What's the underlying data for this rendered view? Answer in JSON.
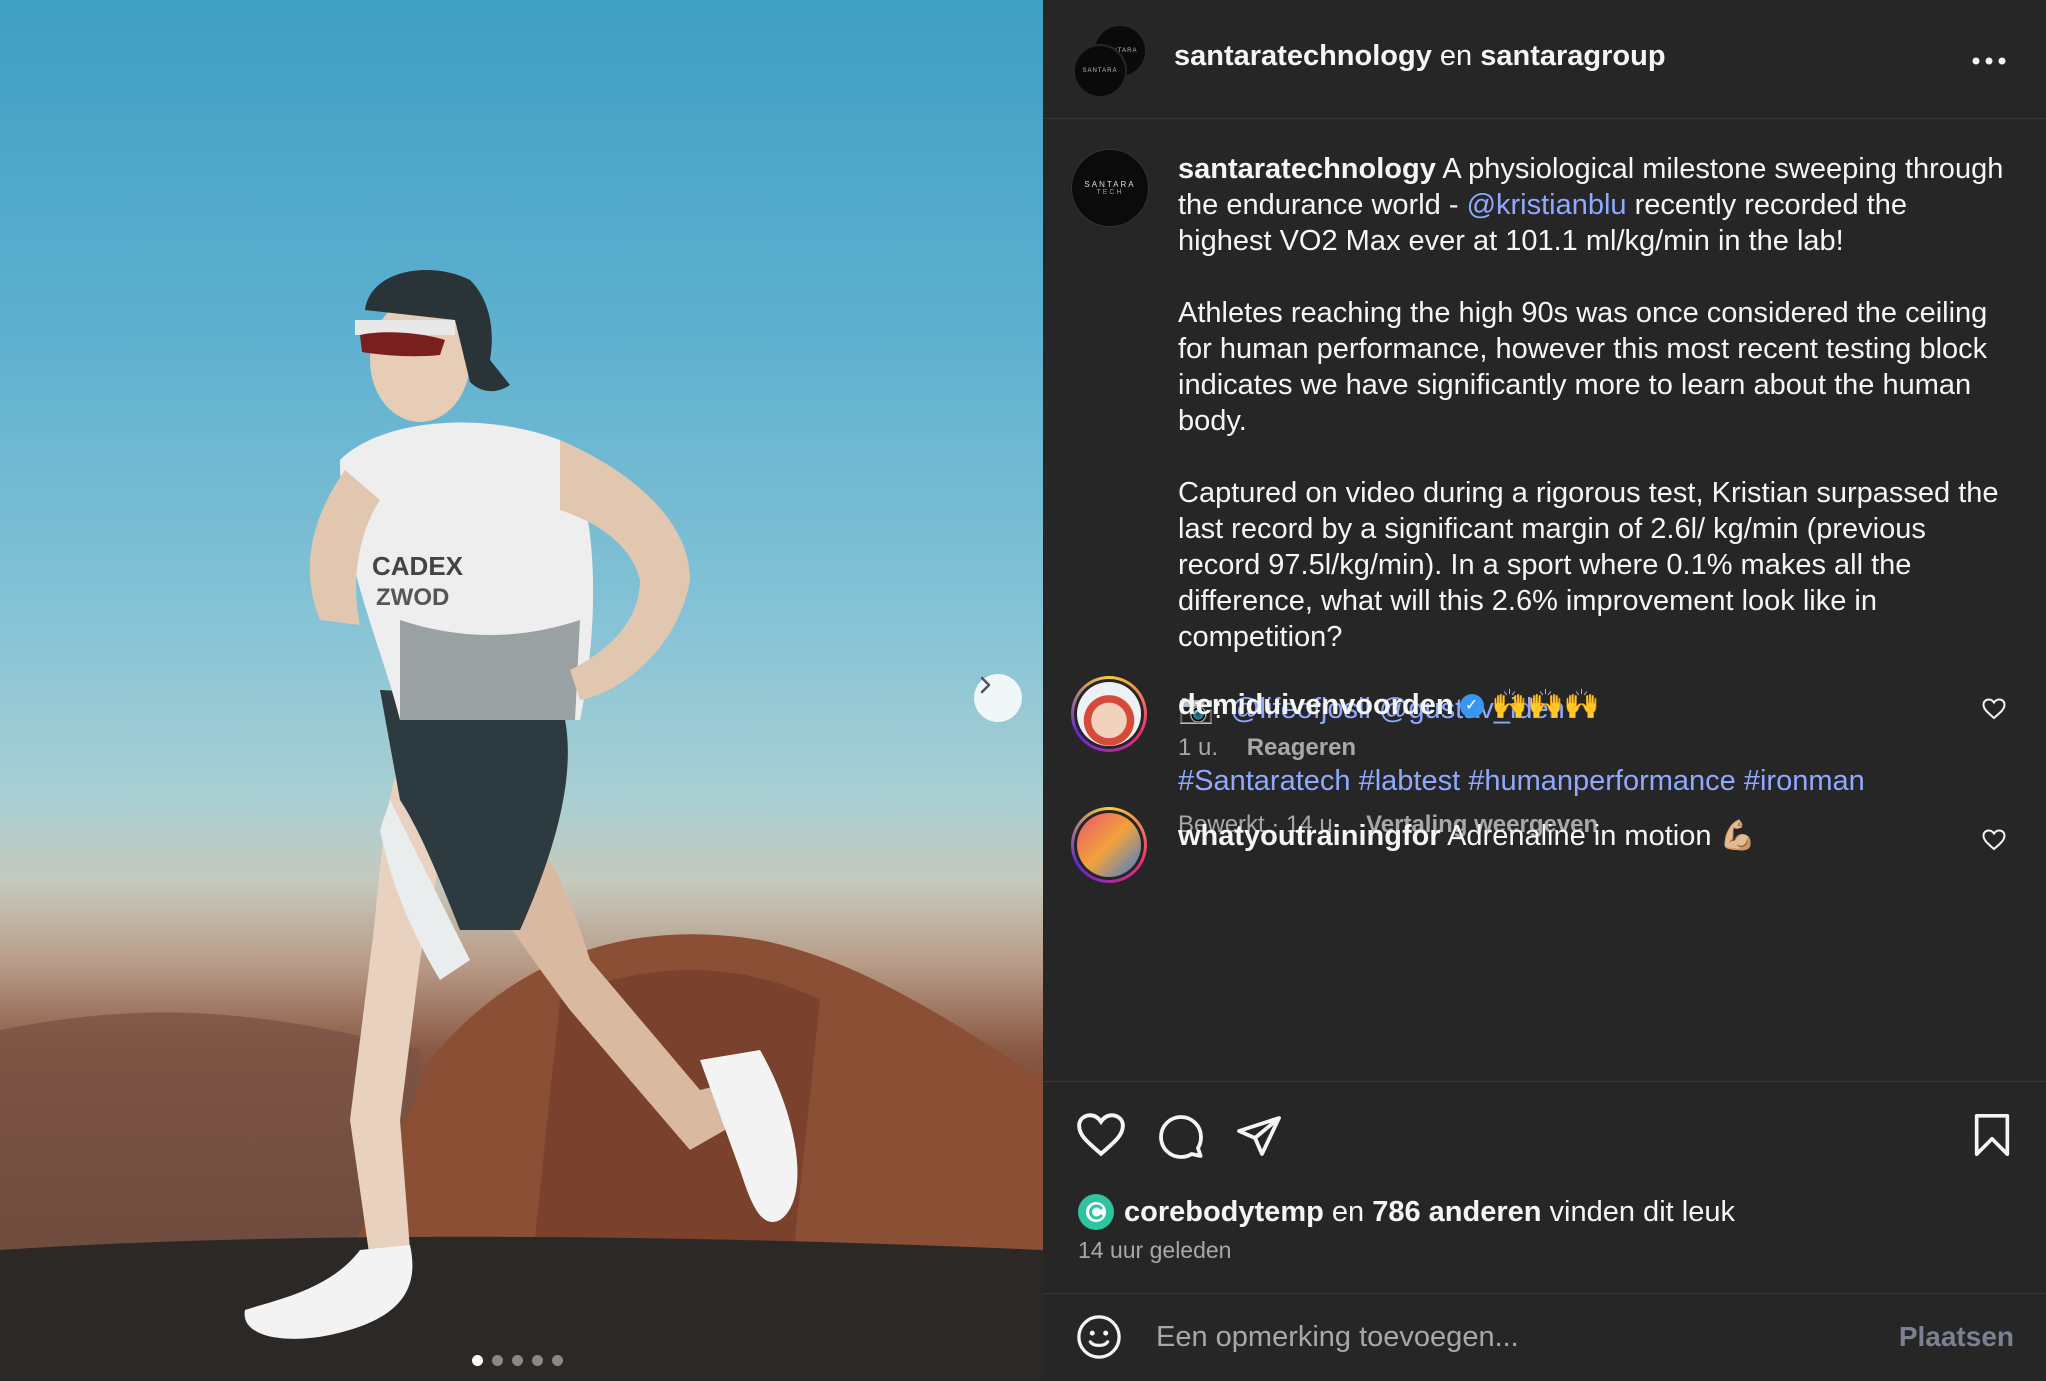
{
  "header": {
    "user1": "santaratechnology",
    "joiner": "en",
    "user2": "santaragroup",
    "avatar_text": "SANTARA"
  },
  "caption": {
    "avatar_line1": "SANTARA",
    "avatar_line2": "TECH",
    "username": "santaratechnology",
    "p1_a": "A physiological milestone sweeping through the endurance world - ",
    "p1_mention": "@kristianblu",
    "p1_b": " recently recorded the highest VO2 Max ever at 101.1 ml/kg/min in the lab!",
    "p2": "Athletes reaching the high 90s was once considered the ceiling for human performance, however this most recent testing block indicates we have significantly more to learn about the human body.",
    "p3": "Captured on video during a rigorous test, Kristian surpassed the last record by a significant margin of 2.6l/ kg/min (previous record 97.5l/kg/min). In a sport where 0.1% makes all the difference, what will this 2.6% improvement look like in competition?",
    "camera": "📷:",
    "credit1": "@lifeofjosii",
    "credit2": "@gustav_iden",
    "hashtags": "#Santaratech #labtest #humanperformance #ironman",
    "edited": "Bewerkt · 14 u.",
    "translate": "Vertaling weergeven"
  },
  "comments": [
    {
      "username": "demiduivenvoorden",
      "verified": "✓",
      "text": "🙌🙌🙌",
      "time": "1 u.",
      "reply": "Reageren"
    },
    {
      "username": "whatyoutrainingfor",
      "text": "Adrenaline in motion 💪🏼"
    }
  ],
  "likes": {
    "user": "corebodytemp",
    "joiner": "en",
    "count": "786 anderen",
    "suffix": "vinden dit leuk",
    "time": "14 uur geleden"
  },
  "composer": {
    "placeholder": "Een opmerking toevoegen...",
    "post": "Plaatsen"
  },
  "carousel": {
    "slide_count": 5,
    "current": 1
  },
  "colors": {
    "background": "#262626",
    "link": "#8ea9ff",
    "muted": "#a8a8a8"
  }
}
